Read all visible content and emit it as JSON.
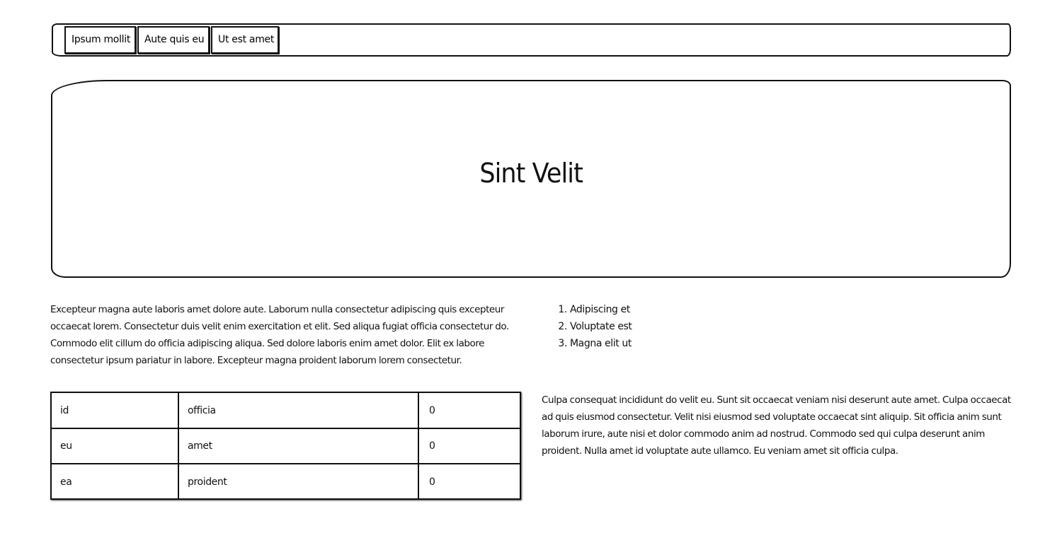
{
  "nav": {
    "tabs": [
      "Ipsum mollit",
      "Aute quis eu",
      "Ut est amet"
    ]
  },
  "hero": {
    "title": "Sint Velit"
  },
  "content": {
    "paragraph_left": "Excepteur magna aute laboris amet dolore aute. Laborum nulla consectetur adipiscing quis excepteur occaecat lorem. Consectetur duis velit enim exercitation et elit. Sed aliqua fugiat officia consectetur do. Commodo elit cillum do officia adipiscing aliqua. Sed dolore laboris enim amet dolor. Elit ex labore consectetur ipsum pariatur in labore. Excepteur magna proident laborum lorem consectetur.",
    "list": [
      "Adipiscing et",
      "Voluptate est",
      "Magna elit ut"
    ],
    "paragraph_right": "Culpa consequat incididunt do velit eu. Sunt sit occaecat veniam nisi deserunt aute amet. Culpa occaecat ad quis eiusmod consectetur. Velit nisi eiusmod sed voluptate occaecat sint aliquip. Sit officia anim sunt laborum irure, aute nisi et dolor commodo anim ad nostrud. Commodo sed qui culpa deserunt anim proident. Nulla amet id voluptate aute ullamco. Eu veniam amet sit officia culpa."
  },
  "table": {
    "rows": [
      [
        "id",
        "officia",
        "0"
      ],
      [
        "eu",
        "amet",
        "0"
      ],
      [
        "ea",
        "proident",
        "0"
      ]
    ]
  }
}
